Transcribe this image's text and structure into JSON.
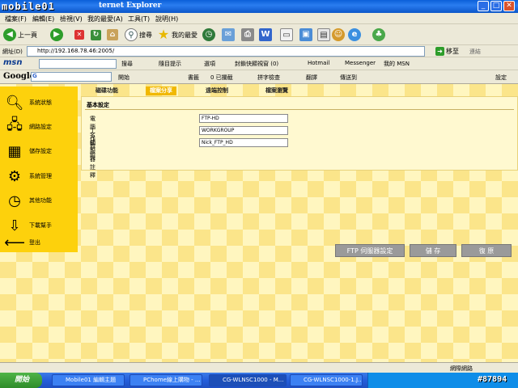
{
  "window": {
    "logo_text": "mobile01",
    "title": "ternet Explorer",
    "min": "_",
    "max": "□",
    "close": "✕"
  },
  "menu": [
    "檔案(F)",
    "編輯(E)",
    "檢視(V)",
    "我的最愛(A)",
    "工具(T)",
    "說明(H)"
  ],
  "toolbar": {
    "back": "上一頁",
    "search": "搜尋",
    "favorites": "我的最愛"
  },
  "address": {
    "label": "網址(D)",
    "url": "http://192.168.78.46:2005/",
    "go": "移至",
    "links": "連結"
  },
  "msnbar": {
    "logo": "msn",
    "search": "搜尋",
    "popup": "隨目提示",
    "options": "選項",
    "blocked": "封鎖快顯視窗 (0)",
    "hotmail": "Hotmail",
    "messenger": "Messenger",
    "mymsn": "我的 MSN"
  },
  "googlebar": {
    "logo": "Google",
    "g": "G",
    "start": "開始",
    "bookmarks": "書籤",
    "blocked": "0 已攔截",
    "spell": "拼字檢查",
    "translate": "翻譯",
    "send": "傳送到",
    "settings": "設定"
  },
  "sidebar": {
    "items": [
      {
        "label": "系統狀態",
        "icon": "magnifier-icon"
      },
      {
        "label": "網路設定",
        "icon": "network-icon"
      },
      {
        "label": "儲存設定",
        "icon": "storage-icon"
      },
      {
        "label": "系統管理",
        "icon": "gears-icon"
      },
      {
        "label": "其他功能",
        "icon": "clock-icon"
      },
      {
        "label": "下載幫手",
        "icon": "download-icon"
      },
      {
        "label": "登出",
        "icon": "logout-arrow-icon"
      }
    ]
  },
  "tabs": [
    {
      "label": "磁碟功能",
      "active": false
    },
    {
      "label": "檔案分享",
      "active": true
    },
    {
      "label": "遠端控制",
      "active": false
    },
    {
      "label": "檔案瀏覽",
      "active": false
    }
  ],
  "form": {
    "section": "基本設定",
    "fields": [
      {
        "label": "電腦名稱",
        "value": "FTP-HD"
      },
      {
        "label": "工作群組",
        "value": "WORKGROUP"
      },
      {
        "label": "伺服器註釋",
        "value": "Nick_FTP_HD"
      }
    ]
  },
  "actions": {
    "ftp": "FTP 伺服器設定",
    "save": "儲 存",
    "restore": "復 原"
  },
  "statusbar": {
    "zone": "網際網路"
  },
  "taskbar": {
    "start": "開始",
    "tasks": [
      "Mobile01 編輯主題",
      "PChome線上購物 - ...",
      "CG-WLNSC1000 - M...",
      "CG-WLNSC1000-1.J..."
    ],
    "watermark": "#87894"
  }
}
